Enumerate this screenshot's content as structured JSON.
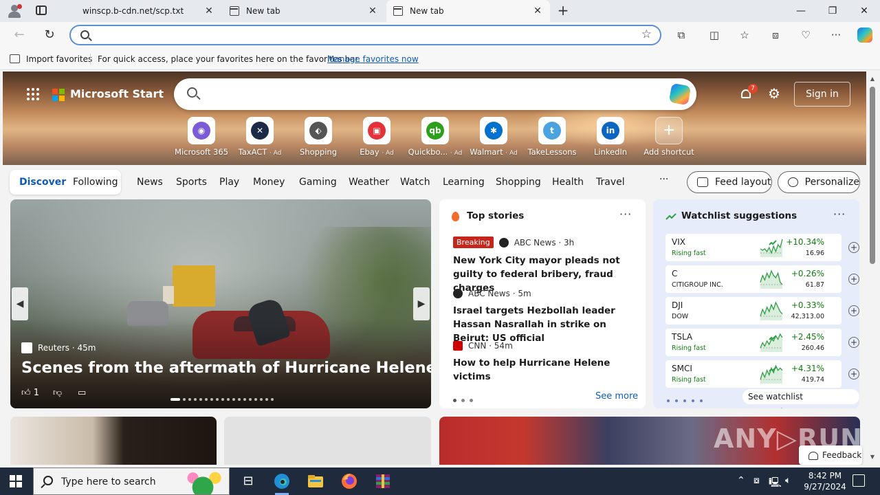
{
  "browser": {
    "tabs": [
      {
        "label": "winscp.b-cdn.net/scp.txt",
        "icon": "page-icon"
      },
      {
        "label": "New tab",
        "icon": "new-tab-icon"
      },
      {
        "label": "New tab",
        "icon": "new-tab-icon",
        "active": true
      }
    ],
    "new_tab_glyph": "+",
    "close_glyph": "✕",
    "address": {
      "value": "",
      "placeholder": ""
    },
    "favorites_bar": {
      "import_label": "Import favorites",
      "message": "For quick access, place your favorites here on the favorites bar.",
      "link": "Manage favorites now"
    }
  },
  "msn": {
    "brand": "Microsoft Start",
    "search_placeholder": "",
    "notifications_count": "7",
    "sign_in": "Sign in",
    "shortcuts": [
      {
        "label": "Microsoft 365",
        "ad": "",
        "color": "#7b5cd6",
        "glyph": "◉"
      },
      {
        "label": "TaxACT",
        "ad": "· Ad",
        "color": "#1c2a48",
        "glyph": "✕"
      },
      {
        "label": "Shopping",
        "ad": "",
        "color": "#555555",
        "glyph": "⬖"
      },
      {
        "label": "Ebay",
        "ad": "· Ad",
        "color": "#e53238",
        "glyph": "▣"
      },
      {
        "label": "Quickbo...",
        "ad": "· Ad",
        "color": "#2ca01c",
        "glyph": "qb"
      },
      {
        "label": "Walmart",
        "ad": "· Ad",
        "color": "#0071ce",
        "glyph": "✱"
      },
      {
        "label": "TakeLessons",
        "ad": "",
        "color": "#4aa3df",
        "glyph": "t"
      },
      {
        "label": "LinkedIn",
        "ad": "",
        "color": "#0a66c2",
        "glyph": "in"
      },
      {
        "label": "Add shortcut",
        "ad": "",
        "color": "#ffffff",
        "glyph": "+"
      }
    ],
    "nav": {
      "pill": [
        "Discover",
        "Following"
      ],
      "links": [
        "News",
        "Sports",
        "Play",
        "Money",
        "Gaming",
        "Weather",
        "Watch",
        "Learning",
        "Shopping",
        "Health",
        "Travel"
      ],
      "more": "···",
      "feed_layout": "Feed layout",
      "personalize": "Personalize"
    },
    "hero": {
      "source": "Reuters",
      "age": "· 45m",
      "headline": "Scenes from the aftermath of Hurricane Helene",
      "likes": "1"
    },
    "top_stories": {
      "title": "Top stories",
      "more": "···",
      "items": [
        {
          "badge": "Breaking",
          "source": "ABC News",
          "age": "· 3h",
          "title": "New York City mayor pleads not guilty to federal bribery, fraud charges",
          "logo_color": "#222222"
        },
        {
          "badge": "",
          "source": "ABC News",
          "age": "· 5m",
          "title": "Israel targets Hezbollah leader Hassan Nasrallah in strike on Beirut: US official",
          "logo_color": "#222222"
        },
        {
          "badge": "",
          "source": "CNN",
          "age": "· 54m",
          "title": "How to help Hurricane Helene victims",
          "logo_color": "#cc0000"
        }
      ],
      "see_more": "See more"
    },
    "watchlist": {
      "title": "Watchlist suggestions",
      "more": "···",
      "stocks": [
        {
          "symbol": "VIX",
          "sub": "Rising fast",
          "rising": true,
          "change": "+10.34%",
          "price": "16.96",
          "trend": [
            10,
            11,
            10,
            12,
            9,
            13,
            8,
            12,
            7,
            9,
            3
          ]
        },
        {
          "symbol": "C",
          "sub": "CITIGROUP INC.",
          "rising": false,
          "change": "+0.26%",
          "price": "61.87",
          "trend": [
            8,
            5,
            7,
            4,
            6,
            3,
            5,
            6,
            4,
            8,
            9
          ]
        },
        {
          "symbol": "DJI",
          "sub": "DOW",
          "rising": false,
          "change": "+0.33%",
          "price": "42,313.00",
          "trend": [
            9,
            6,
            8,
            5,
            7,
            4,
            6,
            3,
            5,
            7,
            8
          ]
        },
        {
          "symbol": "TSLA",
          "sub": "Rising fast",
          "rising": true,
          "change": "+2.45%",
          "price": "260.46",
          "trend": [
            11,
            8,
            10,
            7,
            9,
            6,
            7,
            4,
            6,
            3,
            5
          ]
        },
        {
          "symbol": "SMCI",
          "sub": "Rising fast",
          "rising": true,
          "change": "+4.31%",
          "price": "419.74",
          "trend": [
            10,
            7,
            9,
            6,
            8,
            5,
            7,
            4,
            6,
            5,
            6
          ]
        }
      ],
      "see_all": "See watchlist suggestions"
    },
    "feedback": "Feedback",
    "watermark": "ANY RUN"
  },
  "taskbar": {
    "search_placeholder": "Type here to search",
    "time": "8:42 PM",
    "date": "9/27/2024"
  }
}
